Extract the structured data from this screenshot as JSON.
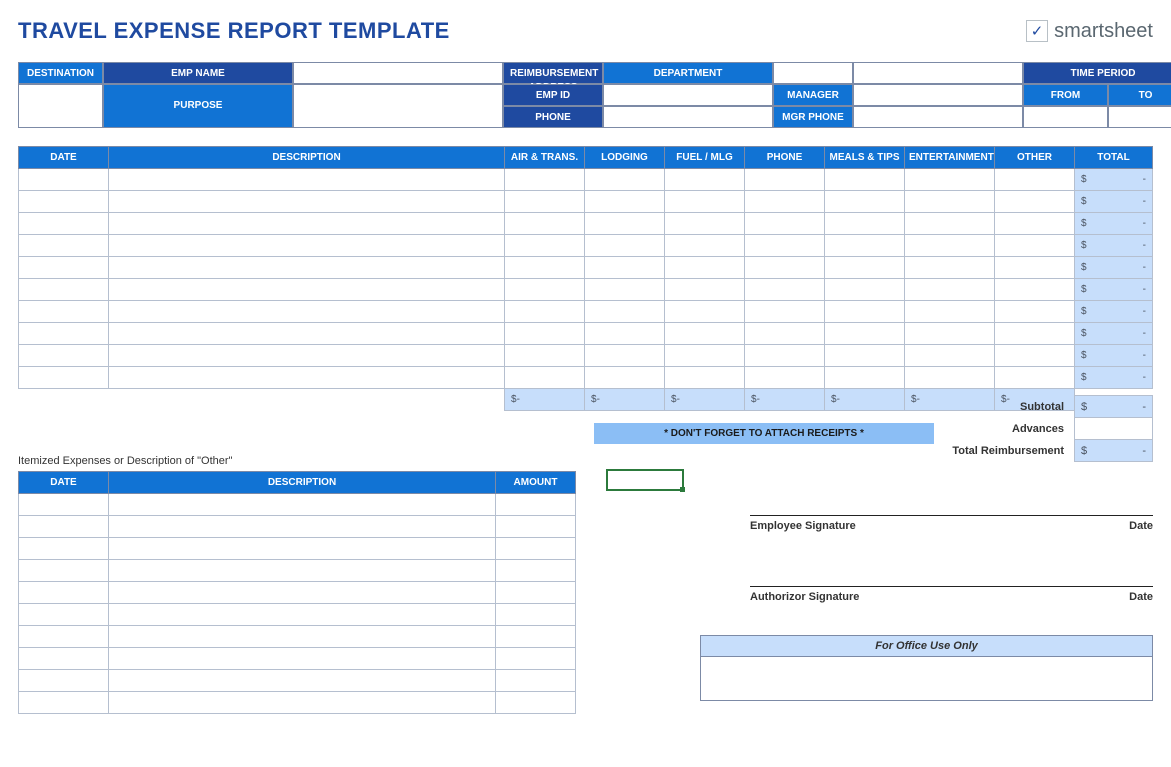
{
  "title": "TRAVEL EXPENSE REPORT TEMPLATE",
  "brand": {
    "name": "smartsheet"
  },
  "info": {
    "empName": "EMP NAME",
    "reimbAddr": "REIMBURSEMENT ADDRESS",
    "department": "DEPARTMENT",
    "destination": "DESTINATION",
    "timePeriod": "TIME PERIOD",
    "empId": "EMP ID",
    "manager": "MANAGER",
    "purpose": "PURPOSE",
    "from": "FROM",
    "to": "TO",
    "phone": "PHONE",
    "mgrPhone": "MGR PHONE"
  },
  "cols": {
    "date": "DATE",
    "description": "DESCRIPTION",
    "air": "AIR & TRANS.",
    "lodging": "LODGING",
    "fuel": "FUEL / MLG",
    "phone": "PHONE",
    "meals": "MEALS & TIPS",
    "ent": "ENTERTAINMENT",
    "other": "OTHER",
    "total": "TOTAL"
  },
  "rowCount": 10,
  "cellTotal": {
    "sym": "$",
    "val": "-"
  },
  "receipts": "* DON'T FORGET TO ATTACH RECEIPTS *",
  "summary": {
    "subtotal": "Subtotal",
    "advances": "Advances",
    "totalReimb": "Total Reimbursement"
  },
  "itemized": {
    "caption": "Itemized Expenses or Description of \"Other\"",
    "date": "DATE",
    "description": "DESCRIPTION",
    "amount": "AMOUNT",
    "rows": 10
  },
  "sig": {
    "emp": "Employee Signature",
    "auth": "Authorizor Signature",
    "date": "Date"
  },
  "office": "For Office Use Only"
}
